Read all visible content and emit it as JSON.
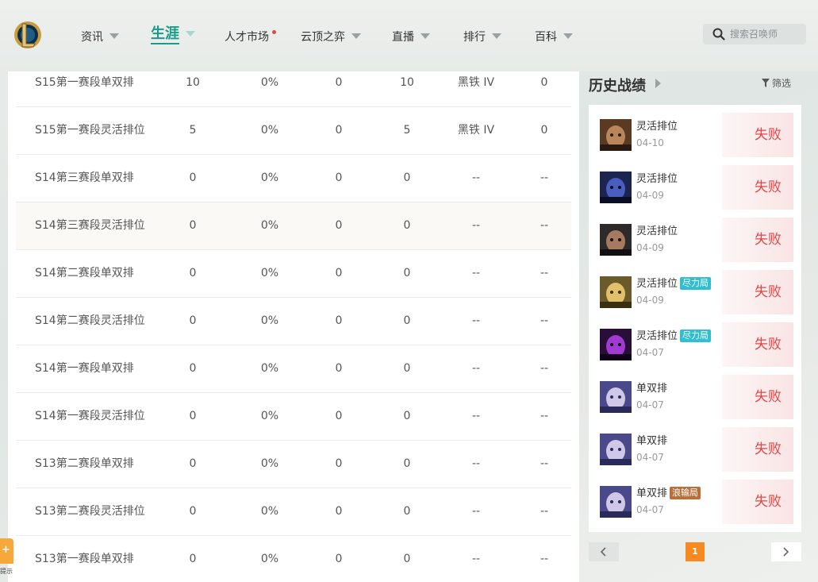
{
  "nav": {
    "items": [
      {
        "label": "资讯",
        "caret": true
      },
      {
        "label": "生涯",
        "caret": true,
        "active": true
      },
      {
        "label": "人才市场",
        "caret": false,
        "dot": true
      },
      {
        "label": "云顶之弈",
        "caret": true
      },
      {
        "label": "直播",
        "caret": true
      },
      {
        "label": "排行",
        "caret": true
      },
      {
        "label": "百科",
        "caret": true
      }
    ],
    "search_placeholder": "搜索召唤师"
  },
  "seasons": {
    "rows": [
      {
        "name": "S15第一赛段单双排",
        "v1": "10",
        "v2": "0%",
        "v3": "0",
        "v4": "10",
        "rank": "黑铁 IV",
        "v6": "0"
      },
      {
        "name": "S15第一赛段灵活排位",
        "v1": "5",
        "v2": "0%",
        "v3": "0",
        "v4": "5",
        "rank": "黑铁 IV",
        "v6": "0"
      },
      {
        "name": "S14第三赛段单双排",
        "v1": "0",
        "v2": "0%",
        "v3": "0",
        "v4": "0",
        "rank": "--",
        "v6": "--"
      },
      {
        "name": "S14第三赛段灵活排位",
        "v1": "0",
        "v2": "0%",
        "v3": "0",
        "v4": "0",
        "rank": "--",
        "v6": "--"
      },
      {
        "name": "S14第二赛段单双排",
        "v1": "0",
        "v2": "0%",
        "v3": "0",
        "v4": "0",
        "rank": "--",
        "v6": "--"
      },
      {
        "name": "S14第二赛段灵活排位",
        "v1": "0",
        "v2": "0%",
        "v3": "0",
        "v4": "0",
        "rank": "--",
        "v6": "--"
      },
      {
        "name": "S14第一赛段单双排",
        "v1": "0",
        "v2": "0%",
        "v3": "0",
        "v4": "0",
        "rank": "--",
        "v6": "--"
      },
      {
        "name": "S14第一赛段灵活排位",
        "v1": "0",
        "v2": "0%",
        "v3": "0",
        "v4": "0",
        "rank": "--",
        "v6": "--"
      },
      {
        "name": "S13第二赛段单双排",
        "v1": "0",
        "v2": "0%",
        "v3": "0",
        "v4": "0",
        "rank": "--",
        "v6": "--"
      },
      {
        "name": "S13第二赛段灵活排位",
        "v1": "0",
        "v2": "0%",
        "v3": "0",
        "v4": "0",
        "rank": "--",
        "v6": "--"
      },
      {
        "name": "S13第一赛段单双排",
        "v1": "0",
        "v2": "0%",
        "v3": "0",
        "v4": "0",
        "rank": "--",
        "v6": "--"
      }
    ]
  },
  "history": {
    "title": "历史战绩",
    "filter_label": "筛选",
    "matches": [
      {
        "mode": "灵活排位",
        "tag": "",
        "date": "04-10",
        "result": "失败",
        "champion_icon": "champion-portrait-darius"
      },
      {
        "mode": "灵活排位",
        "tag": "",
        "date": "04-09",
        "result": "失败",
        "champion_icon": "champion-portrait-dark-blue"
      },
      {
        "mode": "灵活排位",
        "tag": "",
        "date": "04-09",
        "result": "失败",
        "champion_icon": "champion-portrait-swordsman"
      },
      {
        "mode": "灵活排位",
        "tag": "尽力局",
        "tag_color": "#2fbfd0",
        "date": "04-09",
        "result": "失败",
        "champion_icon": "champion-portrait-blonde"
      },
      {
        "mode": "灵活排位",
        "tag": "尽力局",
        "tag_color": "#2fbfd0",
        "date": "04-07",
        "result": "失败",
        "champion_icon": "champion-portrait-void"
      },
      {
        "mode": "单双排",
        "tag": "",
        "date": "04-07",
        "result": "失败",
        "champion_icon": "champion-portrait-yuumi"
      },
      {
        "mode": "单双排",
        "tag": "",
        "date": "04-07",
        "result": "失败",
        "champion_icon": "champion-portrait-yuumi"
      },
      {
        "mode": "单双排",
        "tag": "浪输局",
        "tag_color": "#b8703a",
        "date": "04-07",
        "result": "失败",
        "champion_icon": "champion-portrait-yuumi"
      }
    ]
  },
  "pagination": {
    "current": "1"
  },
  "helper": {
    "label": "提示"
  },
  "colors": {
    "accent": "#1b9b8a",
    "loss": "#e54545",
    "page_active": "#f7891f"
  }
}
